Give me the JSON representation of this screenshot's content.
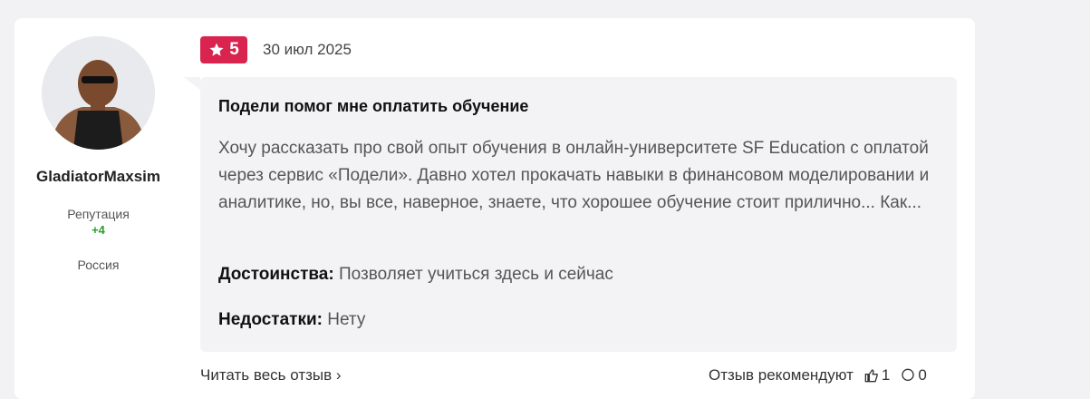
{
  "author": {
    "name": "GladiatorMaxsim",
    "reputation_label": "Репутация",
    "reputation_value": "+4",
    "country": "Россия"
  },
  "review": {
    "rating": "5",
    "date": "30 июл 2025",
    "title": "Подели помог мне оплатить обучение",
    "text": "Хочу рассказать про свой опыт обучения в онлайн-университете SF Education с оплатой через сервис «Подели». Давно хотел прокачать навыки в финансовом моделировании и аналитике, но, вы все, наверное, знаете, что хорошее обучение стоит прилично... Как...",
    "pros_label": "Достоинства:",
    "pros_text": "Позволяет учиться здесь и сейчас",
    "cons_label": "Недостатки:",
    "cons_text": "Нету"
  },
  "footer": {
    "read_more": "Читать весь отзыв",
    "recommend_text": "Отзыв рекомендуют",
    "likes": "1",
    "comments": "0"
  },
  "colors": {
    "rating_badge": "#d8244f",
    "reputation_positive": "#2a9d2a",
    "bubble_bg": "#f3f3f5"
  }
}
